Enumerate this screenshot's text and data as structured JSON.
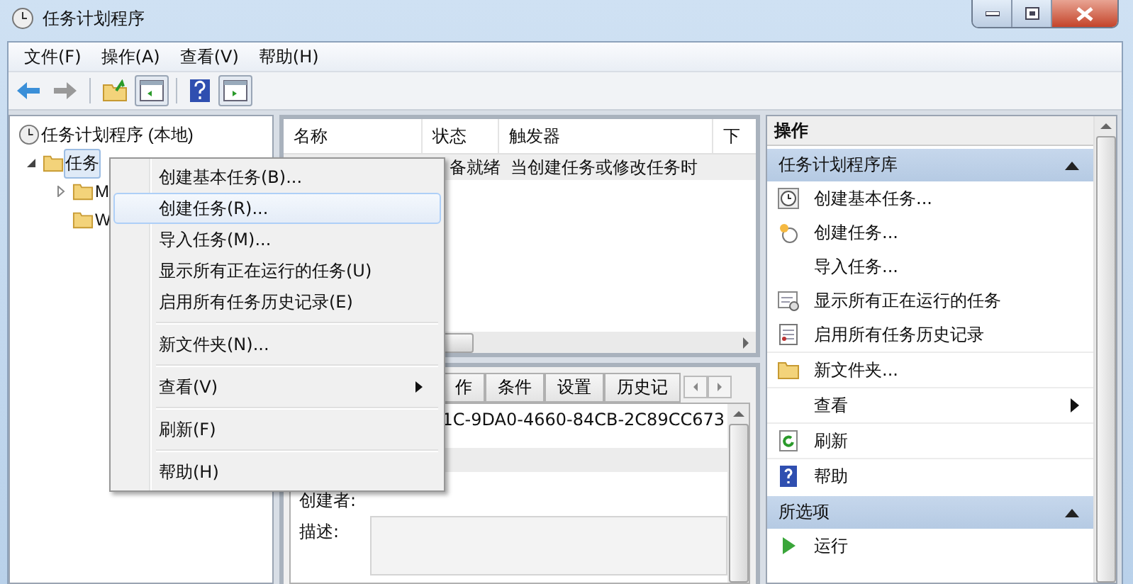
{
  "window": {
    "title": "任务计划程序"
  },
  "menu_bar": [
    "文件(F)",
    "操作(A)",
    "查看(V)",
    "帮助(H)"
  ],
  "tree": [
    {
      "label": "任务计划程序 (本地)",
      "kind": "computer",
      "selected": false,
      "expanded": true,
      "children": [
        {
          "label": "任务",
          "kind": "library",
          "selected": true,
          "expanded": true,
          "children": [
            {
              "label": "M",
              "kind": "folder",
              "selected": false,
              "expanded": false
            },
            {
              "label": "W",
              "kind": "leaf",
              "selected": false,
              "expanded": false
            }
          ]
        }
      ]
    }
  ],
  "task_table": {
    "columns": [
      "名称",
      "状态",
      "触发器",
      "下"
    ],
    "rows": [
      {
        "status": "备就绪",
        "trigger": "当创建任务或修改任务时",
        "selected": true
      }
    ]
  },
  "details": {
    "tabs": [
      {
        "label": "作",
        "selected": false
      },
      {
        "label": "条件",
        "selected": false
      },
      {
        "label": "设置",
        "selected": false
      },
      {
        "label": "历史记",
        "selected": false
      }
    ],
    "id_value": "1C-9DA0-4660-84CB-2C89CC673",
    "labels": [
      "创建者:",
      "描述:"
    ]
  },
  "actions": {
    "title": "操作",
    "sections": [
      {
        "title": "任务计划程序库",
        "expanded": true,
        "items": [
          {
            "label": "创建基本任务...",
            "kind": "wizard"
          },
          {
            "label": "创建任务...",
            "kind": "task"
          },
          {
            "label": "导入任务...",
            "kind": "plain"
          },
          {
            "label": "显示所有正在运行的任务",
            "kind": "running"
          },
          {
            "label": "启用所有任务历史记录",
            "kind": "history"
          },
          {
            "label": "新文件夹...",
            "kind": "folder"
          },
          {
            "label": "查看",
            "kind": "submenu"
          },
          {
            "label": "刷新",
            "kind": "refresh"
          },
          {
            "label": "帮助",
            "kind": "help"
          }
        ]
      },
      {
        "title": "所选项",
        "expanded": true,
        "items": [
          {
            "label": "运行",
            "kind": "run"
          }
        ]
      }
    ]
  },
  "context_menu": {
    "groups": [
      [
        {
          "label": "创建基本任务(B)...",
          "selected": false,
          "submenu": false
        },
        {
          "label": "创建任务(R)...",
          "selected": true,
          "submenu": false
        },
        {
          "label": "导入任务(M)...",
          "selected": false,
          "submenu": false
        },
        {
          "label": "显示所有正在运行的任务(U)",
          "selected": false,
          "submenu": false
        },
        {
          "label": "启用所有任务历史记录(E)",
          "selected": false,
          "submenu": false
        }
      ],
      [
        {
          "label": "新文件夹(N)...",
          "selected": false,
          "submenu": false
        }
      ],
      [
        {
          "label": "查看(V)",
          "selected": false,
          "submenu": true
        }
      ],
      [
        {
          "label": "刷新(F)",
          "selected": false,
          "submenu": false
        }
      ],
      [
        {
          "label": "帮助(H)",
          "selected": false,
          "submenu": false
        }
      ]
    ]
  }
}
